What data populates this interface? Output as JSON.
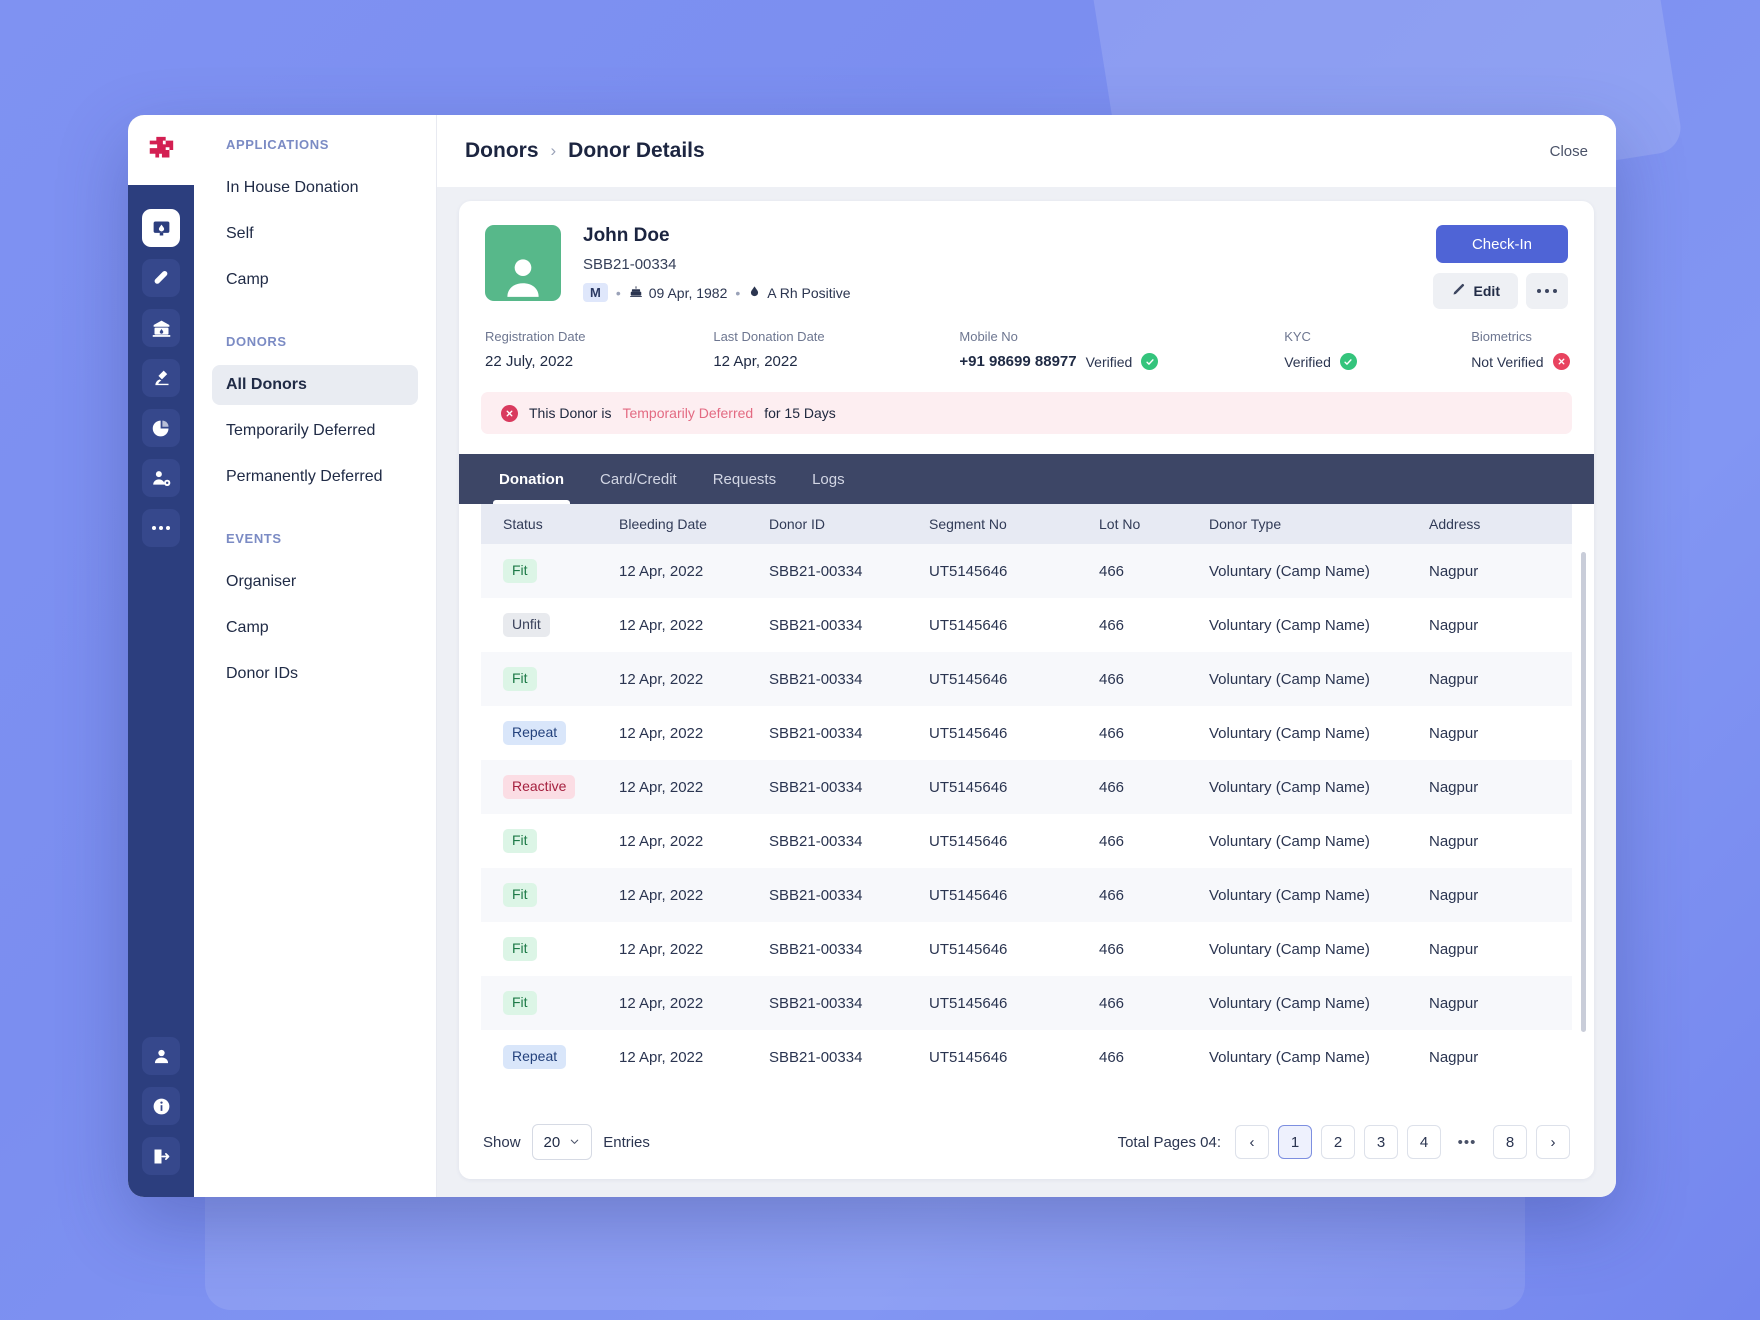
{
  "rail": {
    "logo_name": "blood-bank-logo",
    "items": [
      {
        "name": "monitor-donation-icon",
        "active": true
      },
      {
        "name": "test-tube-icon",
        "active": false
      },
      {
        "name": "blood-bank-icon",
        "active": false
      },
      {
        "name": "microscope-icon",
        "active": false
      },
      {
        "name": "pie-chart-icon",
        "active": false
      },
      {
        "name": "user-settings-icon",
        "active": false
      },
      {
        "name": "more-icon",
        "active": false
      }
    ],
    "bottom_items": [
      {
        "name": "profile-icon"
      },
      {
        "name": "info-icon"
      },
      {
        "name": "logout-icon"
      }
    ]
  },
  "sidebar": {
    "sections": [
      {
        "title": "APPLICATIONS",
        "items": [
          {
            "label": "In House Donation",
            "active": false
          },
          {
            "label": "Self",
            "active": false
          },
          {
            "label": "Camp",
            "active": false
          }
        ]
      },
      {
        "title": "DONORS",
        "items": [
          {
            "label": "All Donors",
            "active": true
          },
          {
            "label": "Temporarily Deferred",
            "active": false
          },
          {
            "label": "Permanently Deferred",
            "active": false
          }
        ]
      },
      {
        "title": "EVENTS",
        "items": [
          {
            "label": "Organiser",
            "active": false
          },
          {
            "label": "Camp",
            "active": false
          },
          {
            "label": "Donor IDs",
            "active": false
          }
        ]
      }
    ]
  },
  "topbar": {
    "breadcrumb_root": "Donors",
    "breadcrumb_sep": "›",
    "breadcrumb_current": "Donor Details",
    "close_label": "Close"
  },
  "donor": {
    "name": "John Doe",
    "id": "SBB21-00334",
    "sex": "M",
    "dob": "09 Apr, 1982",
    "blood_group": "A Rh Positive",
    "checkin_label": "Check-In",
    "edit_label": "Edit",
    "fields": [
      {
        "label": "Registration Date",
        "value": "22 July, 2022"
      },
      {
        "label": "Last Donation Date",
        "value": "12 Apr, 2022"
      },
      {
        "label": "Mobile No",
        "value": "+91 98699 88977",
        "status": "Verified",
        "verified": true
      },
      {
        "label": "KYC",
        "value": "",
        "status": "Verified",
        "verified": true
      },
      {
        "label": "Biometrics",
        "value": "",
        "status": "Not Verified",
        "verified": false
      }
    ],
    "alert": {
      "prefix": "This Donor is",
      "highlight": "Temporarily Deferred",
      "suffix": "for 15 Days"
    }
  },
  "tabs": [
    {
      "label": "Donation",
      "active": true
    },
    {
      "label": "Card/Credit",
      "active": false
    },
    {
      "label": "Requests",
      "active": false
    },
    {
      "label": "Logs",
      "active": false
    }
  ],
  "table": {
    "columns": [
      "Status",
      "Bleeding Date",
      "Donor ID",
      "Segment No",
      "Lot No",
      "Donor Type",
      "Address"
    ],
    "rows": [
      {
        "status": "Fit",
        "status_kind": "fit",
        "bleeding_date": "12 Apr, 2022",
        "donor_id": "SBB21-00334",
        "segment_no": "UT5145646",
        "lot_no": "466",
        "donor_type": "Voluntary (Camp Name)",
        "address": "Nagpur"
      },
      {
        "status": "Unfit",
        "status_kind": "unfit",
        "bleeding_date": "12 Apr, 2022",
        "donor_id": "SBB21-00334",
        "segment_no": "UT5145646",
        "lot_no": "466",
        "donor_type": "Voluntary (Camp Name)",
        "address": "Nagpur"
      },
      {
        "status": "Fit",
        "status_kind": "fit",
        "bleeding_date": "12 Apr, 2022",
        "donor_id": "SBB21-00334",
        "segment_no": "UT5145646",
        "lot_no": "466",
        "donor_type": "Voluntary (Camp Name)",
        "address": "Nagpur"
      },
      {
        "status": "Repeat",
        "status_kind": "repeat",
        "bleeding_date": "12 Apr, 2022",
        "donor_id": "SBB21-00334",
        "segment_no": "UT5145646",
        "lot_no": "466",
        "donor_type": "Voluntary (Camp Name)",
        "address": "Nagpur"
      },
      {
        "status": "Reactive",
        "status_kind": "reactive",
        "bleeding_date": "12 Apr, 2022",
        "donor_id": "SBB21-00334",
        "segment_no": "UT5145646",
        "lot_no": "466",
        "donor_type": "Voluntary (Camp Name)",
        "address": "Nagpur"
      },
      {
        "status": "Fit",
        "status_kind": "fit",
        "bleeding_date": "12 Apr, 2022",
        "donor_id": "SBB21-00334",
        "segment_no": "UT5145646",
        "lot_no": "466",
        "donor_type": "Voluntary (Camp Name)",
        "address": "Nagpur"
      },
      {
        "status": "Fit",
        "status_kind": "fit",
        "bleeding_date": "12 Apr, 2022",
        "donor_id": "SBB21-00334",
        "segment_no": "UT5145646",
        "lot_no": "466",
        "donor_type": "Voluntary (Camp Name)",
        "address": "Nagpur"
      },
      {
        "status": "Fit",
        "status_kind": "fit",
        "bleeding_date": "12 Apr, 2022",
        "donor_id": "SBB21-00334",
        "segment_no": "UT5145646",
        "lot_no": "466",
        "donor_type": "Voluntary (Camp Name)",
        "address": "Nagpur"
      },
      {
        "status": "Fit",
        "status_kind": "fit",
        "bleeding_date": "12 Apr, 2022",
        "donor_id": "SBB21-00334",
        "segment_no": "UT5145646",
        "lot_no": "466",
        "donor_type": "Voluntary (Camp Name)",
        "address": "Nagpur"
      },
      {
        "status": "Repeat",
        "status_kind": "repeat",
        "bleeding_date": "12 Apr, 2022",
        "donor_id": "SBB21-00334",
        "segment_no": "UT5145646",
        "lot_no": "466",
        "donor_type": "Voluntary (Camp Name)",
        "address": "Nagpur"
      }
    ]
  },
  "footer": {
    "show_label": "Show",
    "entries_value": "20",
    "entries_label": "Entries",
    "total_pages_label": "Total Pages 04:",
    "pages": [
      "1",
      "2",
      "3",
      "4",
      "•••",
      "8"
    ],
    "active_page": "1",
    "prev_glyph": "‹",
    "next_glyph": "›"
  },
  "colors": {
    "accent_blue": "#4f64d6",
    "rail_navy": "#2c3e7e",
    "tabbar_navy": "#3d4666",
    "avatar_green": "#57b88a",
    "logo_crimson": "#d31f52",
    "verified_green": "#34c47c",
    "error_red": "#e8435f",
    "page_bg": "#7b8ef0"
  }
}
